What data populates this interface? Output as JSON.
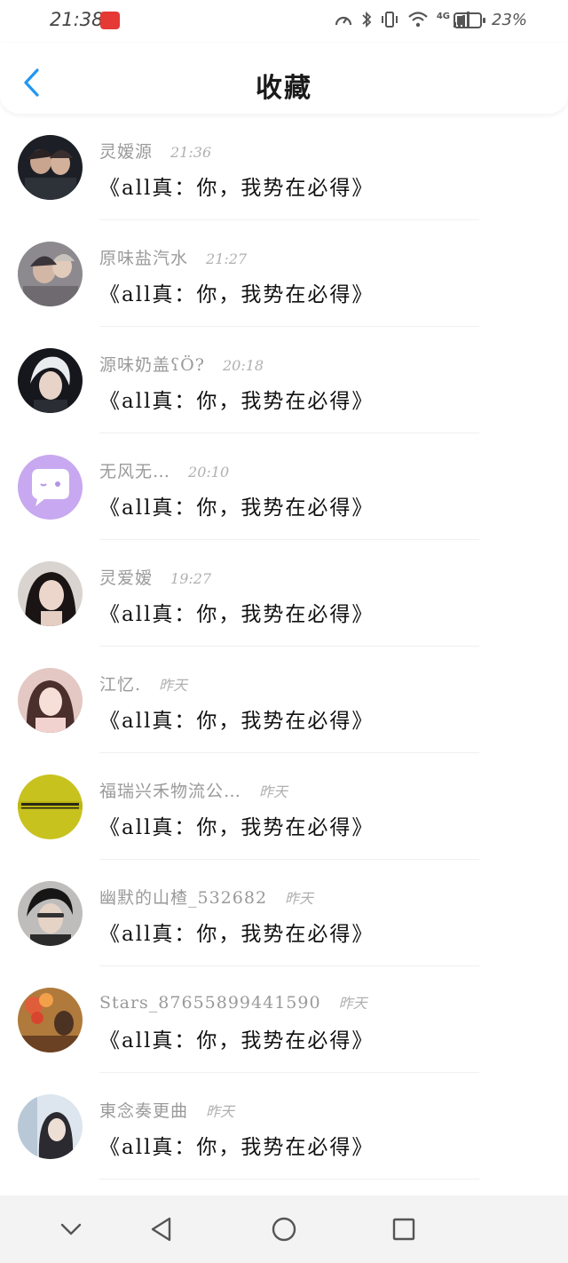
{
  "status_bar": {
    "time": "21:38",
    "network": "4G",
    "battery": "23%",
    "battery_level": 0.23,
    "icons": [
      "speed-icon",
      "bluetooth-icon",
      "vibrate-icon",
      "wifi-icon",
      "signal-icon",
      "battery-icon"
    ]
  },
  "header": {
    "title": "收藏",
    "back_icon": "chevron-left-icon",
    "accent_color": "#2196f3"
  },
  "items": [
    {
      "name": "灵嫒源",
      "time": "21:36",
      "content": "《all真：你，我势在必得》",
      "avatar": "photo"
    },
    {
      "name": "原味盐汽水",
      "time": "21:27",
      "content": "《all真：你，我势在必得》",
      "avatar": "photo"
    },
    {
      "name": "源味奶盖ʕÖ?",
      "time": "20:18",
      "content": "《all真：你，我势在必得》",
      "avatar": "photo"
    },
    {
      "name": "无风无…",
      "time": "20:10",
      "content": "《all真：你，我势在必得》",
      "avatar": "chat-bubble-icon"
    },
    {
      "name": "灵爱嫒",
      "time": "19:27",
      "content": "《all真：你，我势在必得》",
      "avatar": "photo"
    },
    {
      "name": "江忆.",
      "time": "昨天",
      "content": "《all真：你，我势在必得》",
      "avatar": "photo"
    },
    {
      "name": "福瑞兴禾物流公…",
      "time": "昨天",
      "content": "《all真：你，我势在必得》",
      "avatar": "logo"
    },
    {
      "name": "幽默的山楂_532682",
      "time": "昨天",
      "content": "《all真：你，我势在必得》",
      "avatar": "photo"
    },
    {
      "name": "Stars_87655899441590",
      "time": "昨天",
      "content": "《all真：你，我势在必得》",
      "avatar": "photo"
    },
    {
      "name": "東念奏更曲",
      "time": "昨天",
      "content": "《all真：你，我势在必得》",
      "avatar": "photo"
    }
  ],
  "nav_bar": {
    "buttons": [
      "chevron-down-icon",
      "back-triangle-icon",
      "home-circle-icon",
      "recents-square-icon"
    ]
  }
}
